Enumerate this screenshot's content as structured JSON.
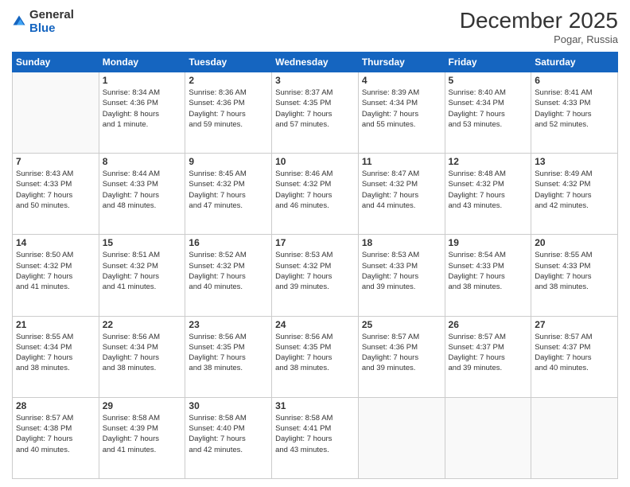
{
  "header": {
    "logo_general": "General",
    "logo_blue": "Blue",
    "month_title": "December 2025",
    "location": "Pogar, Russia"
  },
  "days_of_week": [
    "Sunday",
    "Monday",
    "Tuesday",
    "Wednesday",
    "Thursday",
    "Friday",
    "Saturday"
  ],
  "weeks": [
    [
      {
        "day": "",
        "info": ""
      },
      {
        "day": "1",
        "info": "Sunrise: 8:34 AM\nSunset: 4:36 PM\nDaylight: 8 hours\nand 1 minute."
      },
      {
        "day": "2",
        "info": "Sunrise: 8:36 AM\nSunset: 4:36 PM\nDaylight: 7 hours\nand 59 minutes."
      },
      {
        "day": "3",
        "info": "Sunrise: 8:37 AM\nSunset: 4:35 PM\nDaylight: 7 hours\nand 57 minutes."
      },
      {
        "day": "4",
        "info": "Sunrise: 8:39 AM\nSunset: 4:34 PM\nDaylight: 7 hours\nand 55 minutes."
      },
      {
        "day": "5",
        "info": "Sunrise: 8:40 AM\nSunset: 4:34 PM\nDaylight: 7 hours\nand 53 minutes."
      },
      {
        "day": "6",
        "info": "Sunrise: 8:41 AM\nSunset: 4:33 PM\nDaylight: 7 hours\nand 52 minutes."
      }
    ],
    [
      {
        "day": "7",
        "info": "Sunrise: 8:43 AM\nSunset: 4:33 PM\nDaylight: 7 hours\nand 50 minutes."
      },
      {
        "day": "8",
        "info": "Sunrise: 8:44 AM\nSunset: 4:33 PM\nDaylight: 7 hours\nand 48 minutes."
      },
      {
        "day": "9",
        "info": "Sunrise: 8:45 AM\nSunset: 4:32 PM\nDaylight: 7 hours\nand 47 minutes."
      },
      {
        "day": "10",
        "info": "Sunrise: 8:46 AM\nSunset: 4:32 PM\nDaylight: 7 hours\nand 46 minutes."
      },
      {
        "day": "11",
        "info": "Sunrise: 8:47 AM\nSunset: 4:32 PM\nDaylight: 7 hours\nand 44 minutes."
      },
      {
        "day": "12",
        "info": "Sunrise: 8:48 AM\nSunset: 4:32 PM\nDaylight: 7 hours\nand 43 minutes."
      },
      {
        "day": "13",
        "info": "Sunrise: 8:49 AM\nSunset: 4:32 PM\nDaylight: 7 hours\nand 42 minutes."
      }
    ],
    [
      {
        "day": "14",
        "info": "Sunrise: 8:50 AM\nSunset: 4:32 PM\nDaylight: 7 hours\nand 41 minutes."
      },
      {
        "day": "15",
        "info": "Sunrise: 8:51 AM\nSunset: 4:32 PM\nDaylight: 7 hours\nand 41 minutes."
      },
      {
        "day": "16",
        "info": "Sunrise: 8:52 AM\nSunset: 4:32 PM\nDaylight: 7 hours\nand 40 minutes."
      },
      {
        "day": "17",
        "info": "Sunrise: 8:53 AM\nSunset: 4:32 PM\nDaylight: 7 hours\nand 39 minutes."
      },
      {
        "day": "18",
        "info": "Sunrise: 8:53 AM\nSunset: 4:33 PM\nDaylight: 7 hours\nand 39 minutes."
      },
      {
        "day": "19",
        "info": "Sunrise: 8:54 AM\nSunset: 4:33 PM\nDaylight: 7 hours\nand 38 minutes."
      },
      {
        "day": "20",
        "info": "Sunrise: 8:55 AM\nSunset: 4:33 PM\nDaylight: 7 hours\nand 38 minutes."
      }
    ],
    [
      {
        "day": "21",
        "info": "Sunrise: 8:55 AM\nSunset: 4:34 PM\nDaylight: 7 hours\nand 38 minutes."
      },
      {
        "day": "22",
        "info": "Sunrise: 8:56 AM\nSunset: 4:34 PM\nDaylight: 7 hours\nand 38 minutes."
      },
      {
        "day": "23",
        "info": "Sunrise: 8:56 AM\nSunset: 4:35 PM\nDaylight: 7 hours\nand 38 minutes."
      },
      {
        "day": "24",
        "info": "Sunrise: 8:56 AM\nSunset: 4:35 PM\nDaylight: 7 hours\nand 38 minutes."
      },
      {
        "day": "25",
        "info": "Sunrise: 8:57 AM\nSunset: 4:36 PM\nDaylight: 7 hours\nand 39 minutes."
      },
      {
        "day": "26",
        "info": "Sunrise: 8:57 AM\nSunset: 4:37 PM\nDaylight: 7 hours\nand 39 minutes."
      },
      {
        "day": "27",
        "info": "Sunrise: 8:57 AM\nSunset: 4:37 PM\nDaylight: 7 hours\nand 40 minutes."
      }
    ],
    [
      {
        "day": "28",
        "info": "Sunrise: 8:57 AM\nSunset: 4:38 PM\nDaylight: 7 hours\nand 40 minutes."
      },
      {
        "day": "29",
        "info": "Sunrise: 8:58 AM\nSunset: 4:39 PM\nDaylight: 7 hours\nand 41 minutes."
      },
      {
        "day": "30",
        "info": "Sunrise: 8:58 AM\nSunset: 4:40 PM\nDaylight: 7 hours\nand 42 minutes."
      },
      {
        "day": "31",
        "info": "Sunrise: 8:58 AM\nSunset: 4:41 PM\nDaylight: 7 hours\nand 43 minutes."
      },
      {
        "day": "",
        "info": ""
      },
      {
        "day": "",
        "info": ""
      },
      {
        "day": "",
        "info": ""
      }
    ]
  ]
}
